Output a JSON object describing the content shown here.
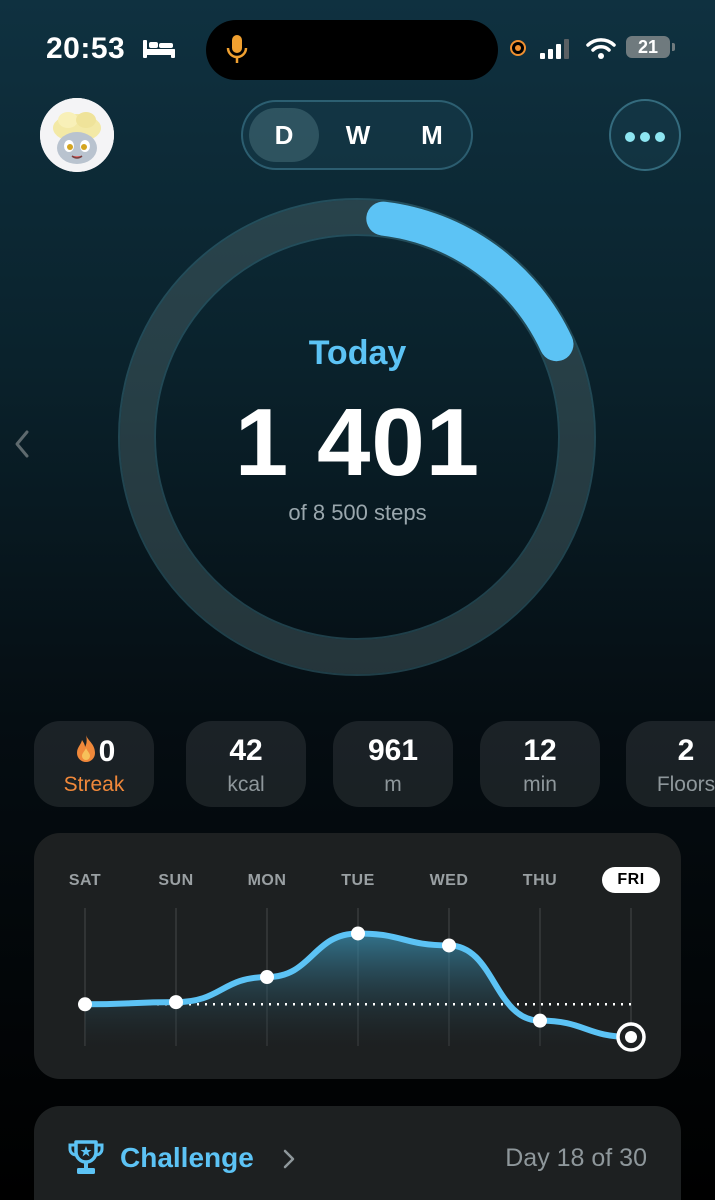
{
  "status_bar": {
    "time": "20:53",
    "battery": "21",
    "icons": [
      "bed-icon",
      "microphone-icon",
      "recording-indicator",
      "cellular-signal-icon",
      "wifi-icon",
      "battery-icon"
    ]
  },
  "period_selector": {
    "options": [
      "D",
      "W",
      "M"
    ],
    "selected": "D"
  },
  "progress": {
    "label": "Today",
    "steps": "1 401",
    "goal_text": "of 8 500 steps",
    "fraction": 0.1648
  },
  "stats": {
    "streak": {
      "value": "0",
      "label": "Streak"
    },
    "calories": {
      "value": "42",
      "label": "kcal"
    },
    "distance": {
      "value": "961",
      "label": "m"
    },
    "time": {
      "value": "12",
      "label": "min"
    },
    "floors": {
      "value": "2",
      "label": "Floors"
    }
  },
  "week": {
    "days": [
      "SAT",
      "SUN",
      "MON",
      "TUE",
      "WED",
      "THU",
      "FRI"
    ],
    "active_day": "FRI",
    "relative_levels": [
      0.3,
      0.32,
      0.55,
      0.95,
      0.84,
      0.15,
      0.0
    ],
    "goal_level": 0.3
  },
  "challenge": {
    "title": "Challenge",
    "progress_text": "Day 18 of 30"
  },
  "colors": {
    "accent": "#5cc3f5",
    "streak": "#f0883a",
    "card": "#1d2021"
  }
}
